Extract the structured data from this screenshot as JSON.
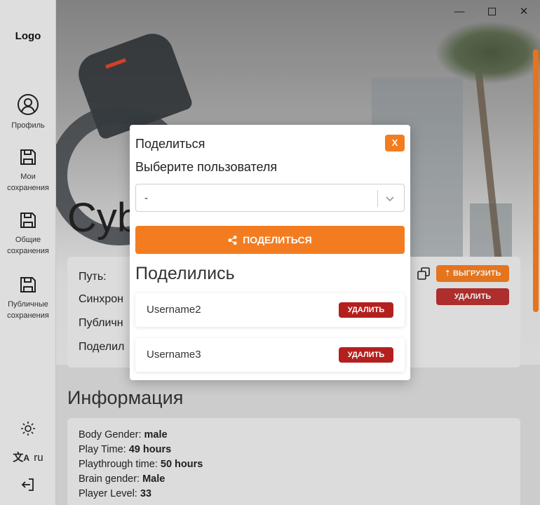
{
  "sidebar": {
    "logo": "Logo",
    "items": [
      {
        "label": "Профиль",
        "icon": "profile-icon"
      },
      {
        "label": "Мои сохранения",
        "icon": "save-icon"
      },
      {
        "label": "Общие сохранения",
        "icon": "save-icon"
      },
      {
        "label": "Публичные сохранения",
        "icon": "save-icon"
      }
    ],
    "theme_icon": "sun-icon",
    "language": "ru",
    "language_icon": "translate-icon",
    "logout_icon": "logout-icon"
  },
  "hero": {
    "title": "Cyb"
  },
  "details": {
    "rows": [
      "Путь:",
      "Синхрон",
      "Публичн",
      "Поделил"
    ],
    "upload_label": "ВЫГРУЗИТЬ",
    "delete_label": "УДАЛИТЬ"
  },
  "info": {
    "title": "Информация",
    "lines": [
      {
        "key": "Body Gender:",
        "value": "male"
      },
      {
        "key": "Play Time:",
        "value": "49 hours"
      },
      {
        "key": "Playthrough time:",
        "value": "50 hours"
      },
      {
        "key": "Brain gender:",
        "value": "Male"
      },
      {
        "key": "Player Level:",
        "value": "33"
      }
    ]
  },
  "modal": {
    "title": "Поделиться",
    "close_label": "X",
    "select_label": "Выберите пользователя",
    "select_value": "-",
    "share_button": "ПОДЕЛИТЬСЯ",
    "shared_title": "Поделились",
    "shared_users": [
      {
        "name": "Username2",
        "delete_label": "УДАЛИТЬ"
      },
      {
        "name": "Username3",
        "delete_label": "УДАЛИТЬ"
      }
    ]
  },
  "colors": {
    "accent": "#f47c20",
    "danger": "#b3201e"
  }
}
